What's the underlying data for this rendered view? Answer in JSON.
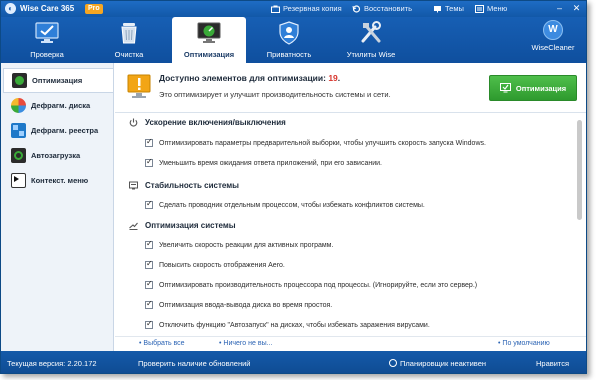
{
  "titlebar": {
    "app_title": "Wise Care 365",
    "pro_badge": "Pro",
    "menu": {
      "backup": "Резервная копия",
      "restore": "Восстановить",
      "themes": "Темы",
      "menu": "Меню"
    }
  },
  "nav": {
    "tabs": [
      {
        "label": "Проверка",
        "icon": "monitor-check-icon"
      },
      {
        "label": "Очистка",
        "icon": "trash-can-icon"
      },
      {
        "label": "Оптимизация",
        "icon": "monitor-gauge-icon",
        "active": true
      },
      {
        "label": "Приватность",
        "icon": "shield-icon"
      },
      {
        "label": "Утилиты Wise",
        "icon": "tools-icon"
      }
    ],
    "brand": "WiseCleaner",
    "brand_letter": "W"
  },
  "sidebar": {
    "items": [
      {
        "label": "Оптимизация",
        "active": true
      },
      {
        "label": "Дефрагм. диска"
      },
      {
        "label": "Дефрагм. реестра"
      },
      {
        "label": "Автозагрузка"
      },
      {
        "label": "Контекст. меню"
      }
    ]
  },
  "banner": {
    "title_prefix": "Доступно элементов для оптимизации:",
    "count": "19",
    "title_suffix": ".",
    "subtitle": "Это оптимизирует и улучшит производительность системы и сети.",
    "button": "Оптимизация"
  },
  "sections": [
    {
      "title": "Ускорение включения/выключения",
      "icon": "power-icon",
      "items": [
        "Оптимизировать параметры предварительной выборки, чтобы улучшить скорость запуска Windows.",
        "Уменьшить время ожидания ответа приложений, при его зависании."
      ]
    },
    {
      "title": "Стабильность системы",
      "icon": "stability-icon",
      "items": [
        "Сделать проводник отдельным процессом, чтобы избежать конфликтов системы."
      ]
    },
    {
      "title": "Оптимизация системы",
      "icon": "system-optimize-icon",
      "items": [
        "Увеличить скорость реакции для активных программ.",
        "Повысить скорость отображения Aero.",
        "Оптимизировать производительность процессора под процессы. (Игнорируйте, если это сервер.)",
        "Оптимизация ввода-вывода диска во время простоя.",
        "Отключить функцию \"Автозапуск\" на дисках, чтобы избежать заражения вирусами."
      ]
    }
  ],
  "bottom_links": {
    "select_all": "Выбрать все",
    "select_none": "Ничего не вы...",
    "default": "По умолчанию"
  },
  "statusbar": {
    "version": "Текущая версия: 2.20.172",
    "check_updates": "Проверить наличие обновлений",
    "scheduler": "Планировщик неактивен",
    "like": "Нравится"
  },
  "colors": {
    "header_blue": "#175fb4",
    "accent_green": "#3aaa38",
    "count_red": "#d8342c",
    "link_blue": "#2c64b4"
  }
}
